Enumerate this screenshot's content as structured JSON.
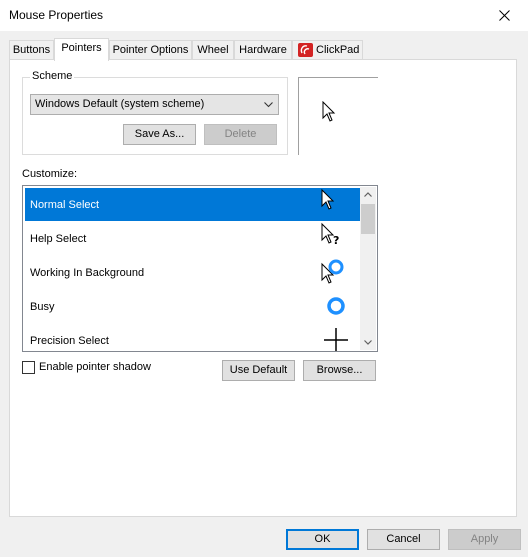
{
  "window": {
    "title": "Mouse Properties",
    "close_icon": "close-icon"
  },
  "tabs": [
    {
      "label": "Buttons"
    },
    {
      "label": "Pointers",
      "active": true
    },
    {
      "label": "Pointer Options"
    },
    {
      "label": "Wheel"
    },
    {
      "label": "Hardware"
    },
    {
      "label": "ClickPad",
      "icon": "clickpad-logo-icon",
      "icon_color": "#d32323"
    }
  ],
  "scheme": {
    "legend": "Scheme",
    "selected": "Windows Default (system scheme)",
    "save_as_label": "Save As...",
    "delete_label": "Delete"
  },
  "customize": {
    "label": "Customize:",
    "items": [
      {
        "label": "Normal Select",
        "icon": "arrow-cursor-icon",
        "selected": true
      },
      {
        "label": "Help Select",
        "icon": "help-cursor-icon"
      },
      {
        "label": "Working In Background",
        "icon": "working-cursor-icon"
      },
      {
        "label": "Busy",
        "icon": "busy-cursor-icon"
      },
      {
        "label": "Precision Select",
        "icon": "crosshair-cursor-icon"
      }
    ]
  },
  "shadow": {
    "label": "Enable pointer shadow",
    "checked": false
  },
  "buttons": {
    "use_default": "Use Default",
    "browse": "Browse...",
    "ok": "OK",
    "cancel": "Cancel",
    "apply": "Apply"
  },
  "colors": {
    "selection": "#0078d7",
    "busy_ring": "#1e90ff"
  }
}
